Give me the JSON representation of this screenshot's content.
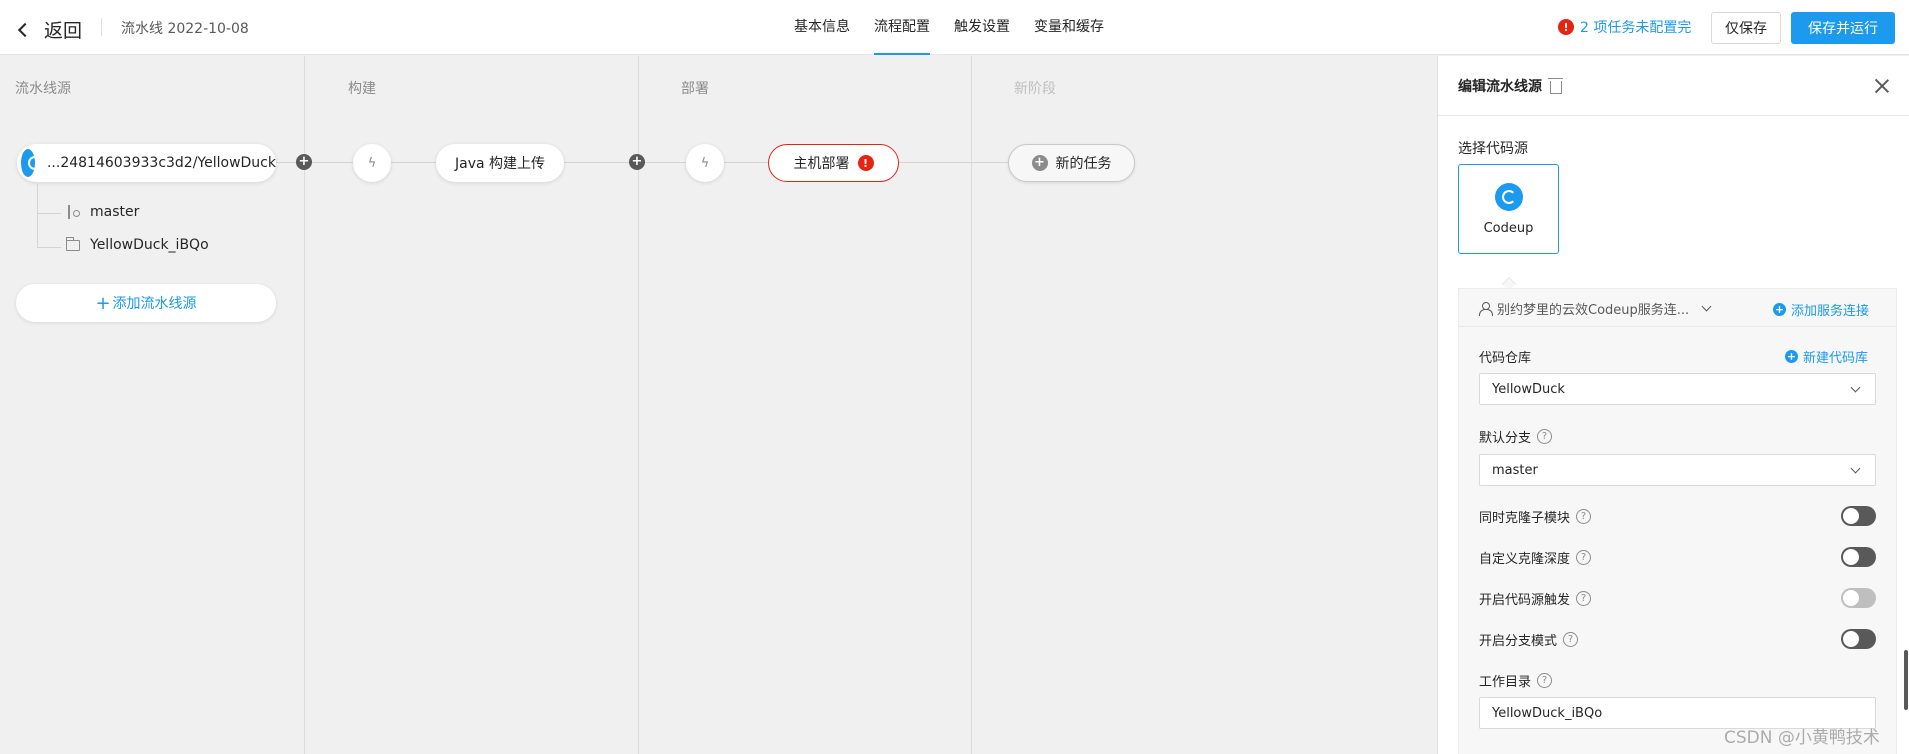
{
  "topbar": {
    "back_label": "返回",
    "pipeline_name": "流水线 2022-10-08",
    "tabs": [
      {
        "label": "基本信息",
        "active": false
      },
      {
        "label": "流程配置",
        "active": true
      },
      {
        "label": "触发设置",
        "active": false
      },
      {
        "label": "变量和缓存",
        "active": false
      }
    ],
    "warning_text": "2 项任务未配置完",
    "save_only_label": "仅保存",
    "save_run_label": "保存并运行"
  },
  "stages": [
    {
      "label": "流水线源"
    },
    {
      "label": "构建"
    },
    {
      "label": "部署"
    },
    {
      "label": "新阶段"
    }
  ],
  "source": {
    "repo_text": "...24814603933c3d2/YellowDuck",
    "branch": "master",
    "directory": "YellowDuck_iBQo",
    "add_source_label": "添加流水线源"
  },
  "tasks": {
    "build_task": "Java 构建上传",
    "deploy_task": "主机部署",
    "new_task": "新的任务"
  },
  "panel": {
    "title": "编辑流水线源",
    "select_source_label": "选择代码源",
    "source_option": "Codeup",
    "connection_text": "别约梦里的云效Codeup服务连...",
    "add_connection_label": "添加服务连接",
    "repo_label": "代码仓库",
    "new_repo_label": "新建代码库",
    "repo_value": "YellowDuck",
    "branch_label": "默认分支",
    "branch_value": "master",
    "toggles": [
      {
        "label": "同时克隆子模块",
        "on": false,
        "disabled": false
      },
      {
        "label": "自定义克隆深度",
        "on": false,
        "disabled": false
      },
      {
        "label": "开启代码源触发",
        "on": false,
        "disabled": true
      },
      {
        "label": "开启分支模式",
        "on": false,
        "disabled": false
      }
    ],
    "workdir_label": "工作目录",
    "workdir_value": "YellowDuck_iBQo"
  },
  "watermark": "CSDN @小黄鸭技术",
  "colors": {
    "accent": "#1b9aee",
    "error": "#e62412",
    "canvas_bg": "#f0f0f0"
  }
}
